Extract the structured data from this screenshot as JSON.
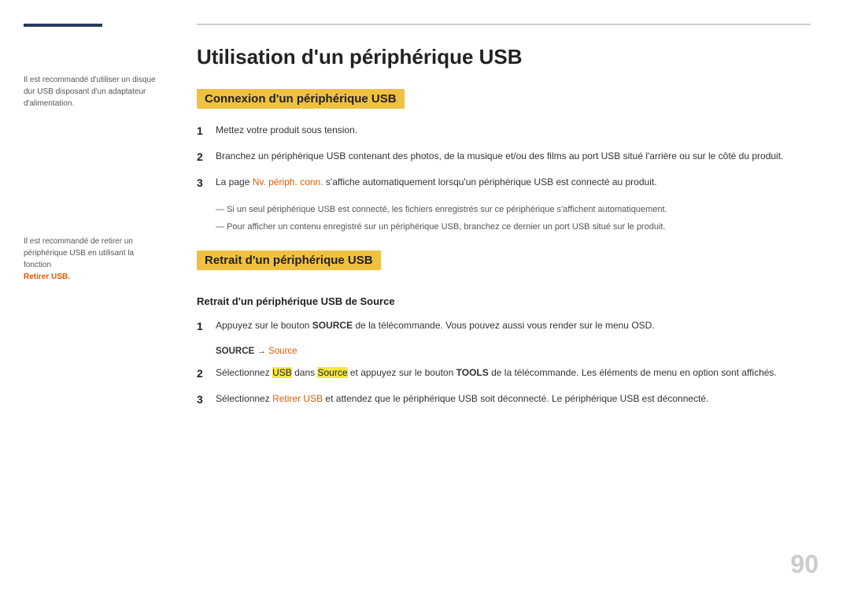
{
  "sidebar": {
    "note1": "Il est recommandé d'utiliser un disque dur USB disposant d'un adaptateur d'alimentation.",
    "note2_part1": "Il est recommandé de retirer un périphérique USB en utilisant la fonction",
    "note2_link": "Retirer USB."
  },
  "main": {
    "top_rule": true,
    "page_title": "Utilisation d'un périphérique USB",
    "section1_heading": "Connexion d'un périphérique USB",
    "step1_1": "Mettez votre produit sous tension.",
    "step1_2": "Branchez un périphérique USB contenant des photos, de la musique et/ou des films au port USB situé   l'arrière ou sur le côté du produit.",
    "step1_3_prefix": "La page",
    "step1_3_link": "Nv. périph. conn.",
    "step1_3_suffix": "s'affiche automatiquement lorsqu'un périphérique USB est connecté au produit.",
    "bullet1": "Si un seul périphérique USB est connecté, les fichiers enregistrés sur ce périphérique s'affichent automatiquement.",
    "bullet2": "Pour afficher un contenu enregistré sur un périphérique USB, branchez ce dernier   un port USB situé sur le produit.",
    "section2_heading": "Retrait d'un périphérique USB",
    "sub_heading": "Retrait d'un périphérique USB de Source",
    "step2_1_prefix": "Appuyez sur le bouton",
    "step2_1_bold": "SOURCE",
    "step2_1_suffix": "de la télécommande. Vous pouvez aussi vous render sur le menu OSD.",
    "source_arrow": "SOURCE → Source",
    "source_arrow_link": "Source",
    "step2_2_prefix": "Sélectionnez",
    "step2_2_usb": "USB",
    "step2_2_middle": "dans",
    "step2_2_source": "Source",
    "step2_2_suffix2": "appuyez sur le bouton",
    "step2_2_tools": "TOOLS",
    "step2_2_suffix3": "de la télécommande. Les éléments de menu en option sont affichés.",
    "step2_3_prefix": "Sélectionnez",
    "step2_3_link": "Retirer USB",
    "step2_3_suffix": "et attendez que le périphérique USB soit déconnecté. Le périphérique USB est déconnecté.",
    "page_number": "90"
  }
}
